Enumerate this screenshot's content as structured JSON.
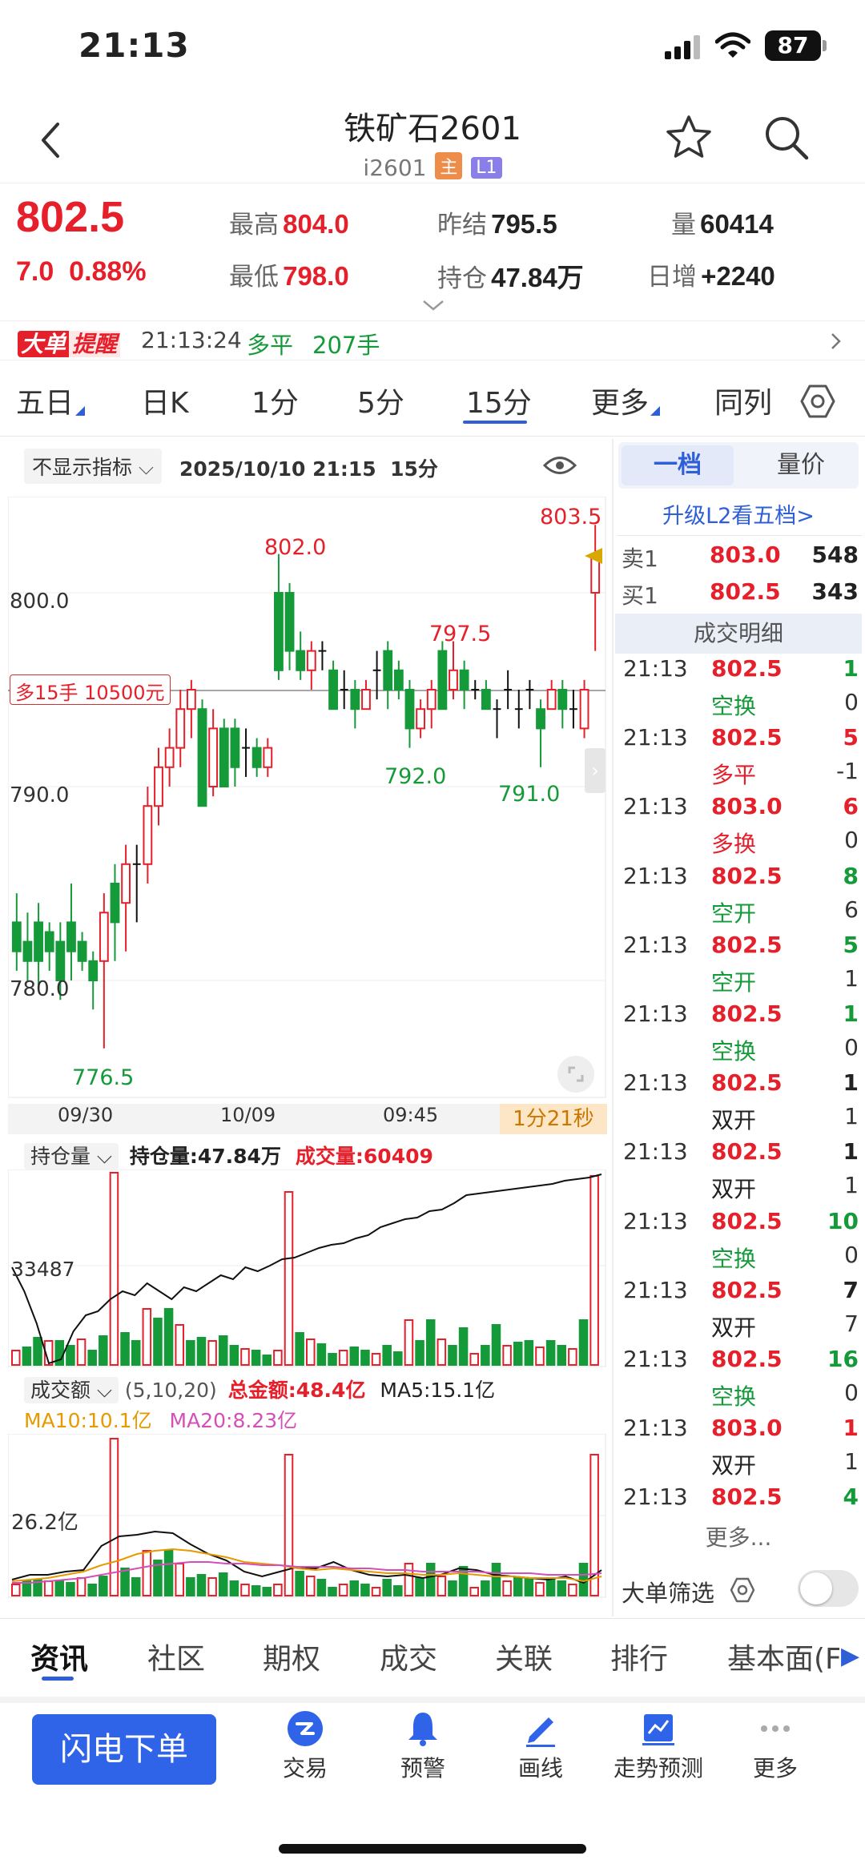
{
  "status_bar": {
    "time": "21:13",
    "battery": "87"
  },
  "header": {
    "title": "铁矿石2601",
    "code": "i2601",
    "tag_main": "主",
    "tag_level": "L1"
  },
  "quote": {
    "last": "802.5",
    "change": "7.0",
    "change_pct": "0.88%",
    "high_label": "最高",
    "high": "804.0",
    "low_label": "最低",
    "low": "798.0",
    "prev_settle_label": "昨结",
    "prev_settle": "795.5",
    "oi_label": "持仓",
    "oi": "47.84万",
    "volume_label": "量",
    "volume": "60414",
    "daily_inc_label": "日增",
    "daily_inc": "+2240"
  },
  "alert": {
    "badge_1": "大单",
    "badge_2": "提醒",
    "time": "21:13:24",
    "type": "多平",
    "lots": "207手"
  },
  "period_tabs": [
    "五日",
    "日K",
    "1分",
    "5分",
    "15分",
    "更多",
    "同列"
  ],
  "chart": {
    "indicator_select": "不显示指标",
    "datetime": "2025/10/10 21:15",
    "period": "15分",
    "position_line_label": "多15手 10500元",
    "countdown": "1分21秒",
    "y_ticks": [
      "800.0",
      "790.0",
      "780.0"
    ],
    "x_ticks": [
      "09/30",
      "10/09",
      "09:45"
    ],
    "annotations": {
      "high_now": "803.5",
      "peak1": "802.0",
      "peak2": "797.5",
      "trough1": "792.0",
      "trough2": "791.0",
      "low": "776.5"
    }
  },
  "oi_panel": {
    "select": "持仓量",
    "oi_text": "持仓量:47.84万",
    "vol_text": "成交量:60409",
    "y_tick": "33487"
  },
  "amount_panel": {
    "select": "成交额",
    "params": "(5,10,20)",
    "total": "总金额:48.4亿",
    "ma5": "MA5:15.1亿",
    "ma10": "MA10:10.1亿",
    "ma20": "MA20:8.23亿",
    "y_tick": "26.2亿"
  },
  "order_book": {
    "tab_1": "一档",
    "tab_2": "量价",
    "upgrade": "升级L2看五档>",
    "ask_label": "卖1",
    "ask_price": "803.0",
    "ask_vol": "548",
    "bid_label": "买1",
    "bid_price": "802.5",
    "bid_vol": "343",
    "detail_title": "成交明细",
    "ticks": [
      {
        "time": "21:13",
        "price": "802.5",
        "vol": "1",
        "type": "空换",
        "chg": "0"
      },
      {
        "time": "21:13",
        "price": "802.5",
        "vol": "5",
        "type": "多平",
        "chg": "-1"
      },
      {
        "time": "21:13",
        "price": "803.0",
        "vol": "6",
        "type": "多换",
        "chg": "0"
      },
      {
        "time": "21:13",
        "price": "802.5",
        "vol": "8",
        "type": "空开",
        "chg": "6"
      },
      {
        "time": "21:13",
        "price": "802.5",
        "vol": "5",
        "type": "空开",
        "chg": "1"
      },
      {
        "time": "21:13",
        "price": "802.5",
        "vol": "1",
        "type": "空换",
        "chg": "0"
      },
      {
        "time": "21:13",
        "price": "802.5",
        "vol": "1",
        "type": "双开",
        "chg": "1"
      },
      {
        "time": "21:13",
        "price": "802.5",
        "vol": "1",
        "type": "双开",
        "chg": "1"
      },
      {
        "time": "21:13",
        "price": "802.5",
        "vol": "10",
        "type": "空换",
        "chg": "0"
      },
      {
        "time": "21:13",
        "price": "802.5",
        "vol": "7",
        "type": "双开",
        "chg": "7"
      },
      {
        "time": "21:13",
        "price": "802.5",
        "vol": "16",
        "type": "空换",
        "chg": "0"
      },
      {
        "time": "21:13",
        "price": "803.0",
        "vol": "1",
        "type": "双开",
        "chg": "1"
      },
      {
        "time": "21:13",
        "price": "802.5",
        "vol": "4",
        "type": "",
        "chg": ""
      }
    ],
    "more": "更多...",
    "filter": "大单筛选"
  },
  "bottom_tabs": [
    "资讯",
    "社区",
    "期权",
    "成交",
    "关联",
    "排行",
    "基本面(F"
  ],
  "actions": {
    "flash_order": "闪电下单",
    "trade": "交易",
    "alert": "预警",
    "draw": "画线",
    "forecast": "走势预测",
    "more": "更多"
  }
}
